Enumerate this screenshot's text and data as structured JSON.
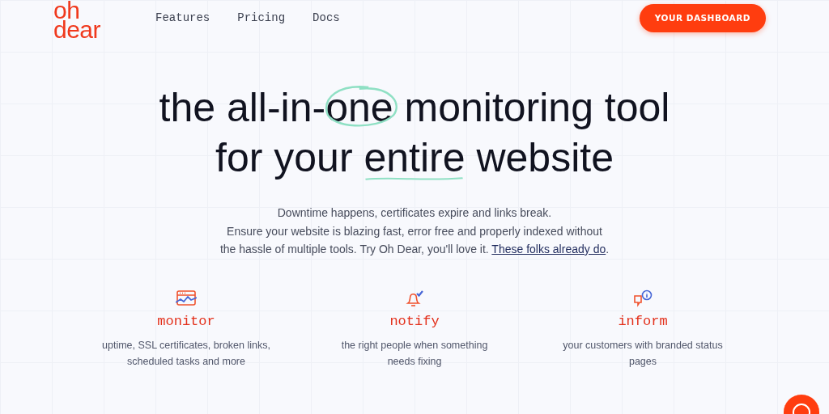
{
  "logo": {
    "lines": [
      "oh",
      "dear"
    ]
  },
  "nav": [
    "Features",
    "Pricing",
    "Docs"
  ],
  "cta": "YOUR DASHBOARD",
  "headline": [
    [
      {
        "text": "the all-in-",
        "kind": "plain"
      },
      {
        "text": "one",
        "kind": "circled"
      },
      {
        "text": " monitoring tool",
        "kind": "plain"
      }
    ],
    [
      {
        "text": "for your ",
        "kind": "plain"
      },
      {
        "text": "entire",
        "kind": "underlined"
      },
      {
        "text": " website",
        "kind": "plain"
      }
    ]
  ],
  "intro": {
    "lines": [
      "Downtime happens, certificates expire and links break.",
      "Ensure your website is blazing fast, error free and properly indexed without",
      "the hassle of multiple tools. Try Oh Dear, you'll love it. "
    ],
    "link": "These folks already do",
    "after": "."
  },
  "features": [
    {
      "kind": "monitor",
      "title": "monitor",
      "lines": [
        "uptime, SSL certificates, broken links,",
        "scheduled tasks and more"
      ]
    },
    {
      "kind": "notify",
      "title": "notify",
      "lines": [
        "the right people when something",
        "needs fixing"
      ]
    },
    {
      "kind": "inform",
      "title": "inform",
      "lines": [
        "your customers with branded status",
        "pages"
      ]
    }
  ]
}
